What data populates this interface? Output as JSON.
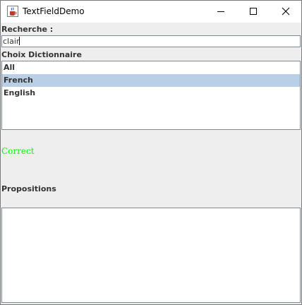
{
  "window": {
    "title": "TextFieldDemo",
    "icon": "java-coffee-icon",
    "controls": [
      "minimize-icon",
      "maximize-icon",
      "close-icon"
    ]
  },
  "search": {
    "label": "Recherche :",
    "value": "clair"
  },
  "dictionary": {
    "label": "Choix Dictionnaire",
    "items": [
      {
        "label": "All",
        "selected": false
      },
      {
        "label": "French",
        "selected": true
      },
      {
        "label": "English",
        "selected": false
      }
    ]
  },
  "status": {
    "text": "Correct",
    "color": "#00ff00"
  },
  "propositions": {
    "label": "Propositions",
    "items": []
  },
  "colors": {
    "selection": "#b8cfe5",
    "panel": "#eeeeee",
    "border": "#7a8a99"
  }
}
